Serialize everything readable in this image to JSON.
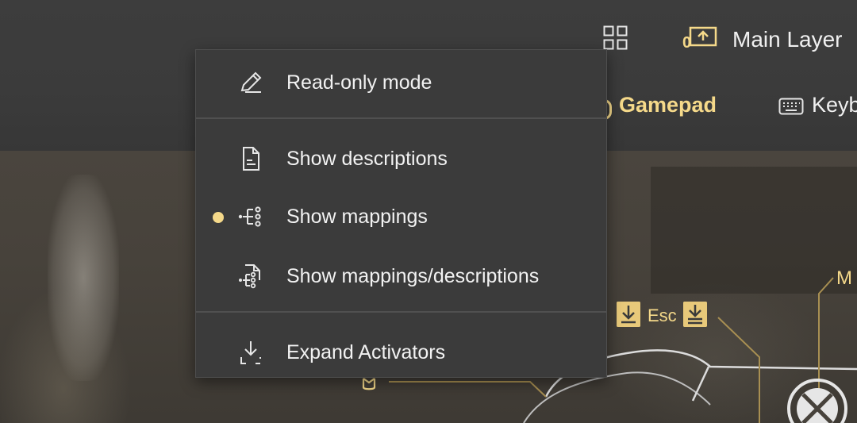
{
  "topbar": {
    "layout_icon": "grid-layout-icon",
    "layer_icon": "layer-upload-icon",
    "layer_label": "Main Layer",
    "layer_number": "0"
  },
  "tabs": {
    "gamepad_label": "Gamepad",
    "keyboard_label": "Keyb"
  },
  "overlay": {
    "esc_label": "Esc",
    "m_label": "M"
  },
  "menu": {
    "items": [
      {
        "label": "Read-only mode",
        "icon": "pencil-icon",
        "selected": false
      },
      {
        "label": "Show descriptions",
        "icon": "document-icon",
        "selected": false
      },
      {
        "label": "Show mappings",
        "icon": "mappings-icon",
        "selected": true
      },
      {
        "label": "Show mappings/descriptions",
        "icon": "mappings-document-icon",
        "selected": false
      },
      {
        "label": "Expand Activators",
        "icon": "expand-activators-icon",
        "selected": false
      }
    ]
  },
  "colors": {
    "accent": "#f5d98a",
    "menu_bg": "#3b3b3b",
    "text": "#f2f2f2"
  }
}
